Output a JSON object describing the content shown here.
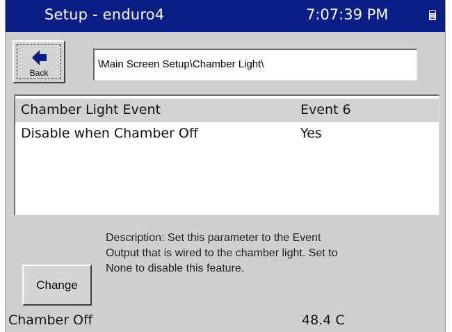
{
  "titlebar": {
    "title": "Setup - enduro4",
    "clock": "7:07:39 PM",
    "icon": "small-window-icon"
  },
  "toolbar": {
    "back_label": "Back",
    "back_icon": "back-arrow-icon",
    "path": "\\Main Screen Setup\\Chamber Light\\"
  },
  "settings": {
    "rows": [
      {
        "name": "Chamber Light Event",
        "value": "Event 6",
        "selected": true
      },
      {
        "name": "Disable when Chamber Off",
        "value": "Yes",
        "selected": false
      }
    ]
  },
  "description": {
    "line1": "Description:  Set this parameter to the Event",
    "line2": "Output that is wired to the chamber light.  Set to",
    "line3": "None to disable this feature."
  },
  "change_label": "Change",
  "status": {
    "state": "Chamber Off",
    "temperature": "48.4 C"
  },
  "colors": {
    "titlebar": "#0a1e86",
    "panel": "#cfcfcf",
    "selected_row": "#d2d2d2"
  }
}
